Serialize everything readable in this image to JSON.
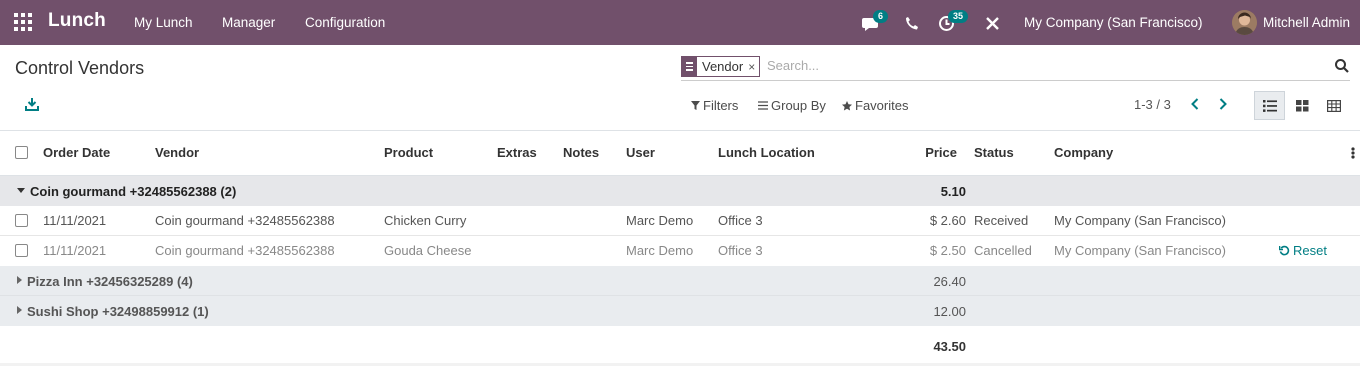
{
  "navbar": {
    "app_name": "Lunch",
    "menus": [
      "My Lunch",
      "Manager",
      "Configuration"
    ],
    "messages_count": "6",
    "activities_count": "35",
    "company": "My Company (San Francisco)",
    "user": "Mitchell Admin",
    "bg_color": "#71506b"
  },
  "control_panel": {
    "title": "Control Vendors",
    "facet_value": "Vendor",
    "facet_remove": "×",
    "search_placeholder": "Search...",
    "filters_label": "Filters",
    "group_by_label": "Group By",
    "favorites_label": "Favorites",
    "pager_text": "1-3 / 3",
    "views": [
      "list",
      "kanban",
      "grid"
    ],
    "active_view": "list"
  },
  "table": {
    "columns": [
      "Order Date",
      "Vendor",
      "Product",
      "Extras",
      "Notes",
      "User",
      "Lunch Location",
      "Price",
      "Status",
      "Company"
    ],
    "groups": [
      {
        "label": "Coin gourmand +32485562388 (2)",
        "total": "5.10",
        "expanded": true,
        "rows": [
          {
            "date": "11/11/2021",
            "vendor": "Coin gourmand +32485562388",
            "product": "Chicken Curry",
            "user": "Marc Demo",
            "location": "Office 3",
            "price": "$ 2.60",
            "status": "Received",
            "company": "My Company (San Francisco)",
            "action": ""
          },
          {
            "date": "11/11/2021",
            "vendor": "Coin gourmand +32485562388",
            "product": "Gouda Cheese",
            "user": "Marc Demo",
            "location": "Office 3",
            "price": "$ 2.50",
            "status": "Cancelled",
            "company": "My Company (San Francisco)",
            "action": "Reset"
          }
        ]
      },
      {
        "label": "Pizza Inn +32456325289 (4)",
        "total": "26.40",
        "expanded": false
      },
      {
        "label": "Sushi Shop +32498859912 (1)",
        "total": "12.00",
        "expanded": false
      }
    ],
    "grand_total": "43.50"
  }
}
